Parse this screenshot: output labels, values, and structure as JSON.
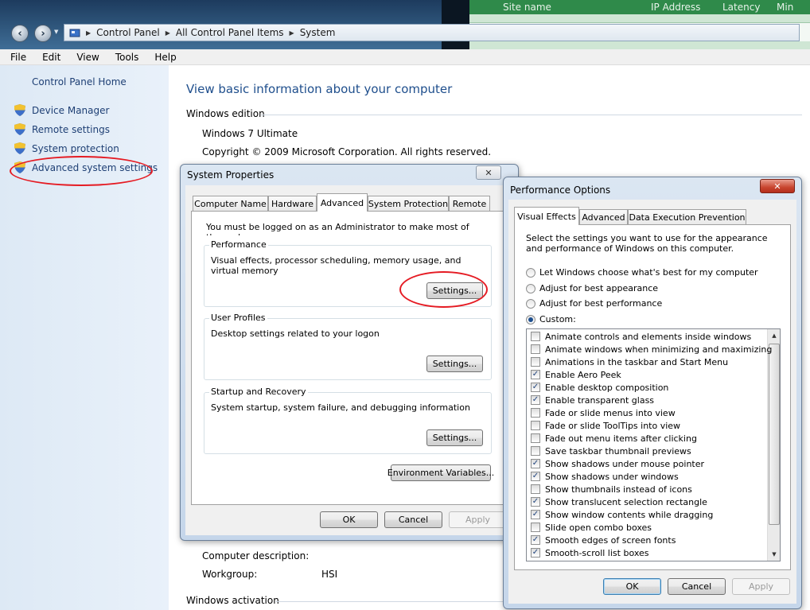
{
  "background_app": {
    "columns": [
      "Site name",
      "IP Address",
      "Latency",
      "Min"
    ]
  },
  "address": {
    "crumbs": [
      "Control Panel",
      "All Control Panel Items",
      "System"
    ]
  },
  "menu": [
    "File",
    "Edit",
    "View",
    "Tools",
    "Help"
  ],
  "left_pane": {
    "home": "Control Panel Home",
    "links": [
      "Device Manager",
      "Remote settings",
      "System protection",
      "Advanced system settings"
    ]
  },
  "main": {
    "heading": "View basic information about your computer",
    "windows_edition_label": "Windows edition",
    "edition": "Windows 7 Ultimate",
    "copyright": "Copyright © 2009 Microsoft Corporation.  All rights reserved.",
    "computer_description_label": "Computer description:",
    "workgroup_label": "Workgroup:",
    "workgroup_value": "HSI",
    "activation_label": "Windows activation"
  },
  "sysprop": {
    "title": "System Properties",
    "tabs": [
      "Computer Name",
      "Hardware",
      "Advanced",
      "System Protection",
      "Remote"
    ],
    "admin_note": "You must be logged on as an Administrator to make most of these changes.",
    "performance": {
      "label": "Performance",
      "desc": "Visual effects, processor scheduling, memory usage, and virtual memory",
      "button": "Settings..."
    },
    "profiles": {
      "label": "User Profiles",
      "desc": "Desktop settings related to your logon",
      "button": "Settings..."
    },
    "startup": {
      "label": "Startup and Recovery",
      "desc": "System startup, system failure, and debugging information",
      "button": "Settings..."
    },
    "env_button": "Environment Variables...",
    "ok": "OK",
    "cancel": "Cancel",
    "apply": "Apply"
  },
  "perf": {
    "title": "Performance Options",
    "tabs": [
      "Visual Effects",
      "Advanced",
      "Data Execution Prevention"
    ],
    "intro": "Select the settings you want to use for the appearance and performance of Windows on this computer.",
    "radios": [
      {
        "label": "Let Windows choose what's best for my computer",
        "selected": false
      },
      {
        "label": "Adjust for best appearance",
        "selected": false
      },
      {
        "label": "Adjust for best performance",
        "selected": false
      },
      {
        "label": "Custom:",
        "selected": true
      }
    ],
    "effects": [
      {
        "label": "Animate controls and elements inside windows",
        "checked": false
      },
      {
        "label": "Animate windows when minimizing and maximizing",
        "checked": false
      },
      {
        "label": "Animations in the taskbar and Start Menu",
        "checked": false
      },
      {
        "label": "Enable Aero Peek",
        "checked": true
      },
      {
        "label": "Enable desktop composition",
        "checked": true
      },
      {
        "label": "Enable transparent glass",
        "checked": true
      },
      {
        "label": "Fade or slide menus into view",
        "checked": false
      },
      {
        "label": "Fade or slide ToolTips into view",
        "checked": false
      },
      {
        "label": "Fade out menu items after clicking",
        "checked": false
      },
      {
        "label": "Save taskbar thumbnail previews",
        "checked": false
      },
      {
        "label": "Show shadows under mouse pointer",
        "checked": true
      },
      {
        "label": "Show shadows under windows",
        "checked": true
      },
      {
        "label": "Show thumbnails instead of icons",
        "checked": false
      },
      {
        "label": "Show translucent selection rectangle",
        "checked": true
      },
      {
        "label": "Show window contents while dragging",
        "checked": true
      },
      {
        "label": "Slide open combo boxes",
        "checked": false
      },
      {
        "label": "Smooth edges of screen fonts",
        "checked": true
      },
      {
        "label": "Smooth-scroll list boxes",
        "checked": true
      }
    ],
    "ok": "OK",
    "cancel": "Cancel",
    "apply": "Apply"
  },
  "colors": {
    "link": "#1e3f74",
    "heading": "#1e4e8c",
    "annotation": "#e51b23"
  }
}
